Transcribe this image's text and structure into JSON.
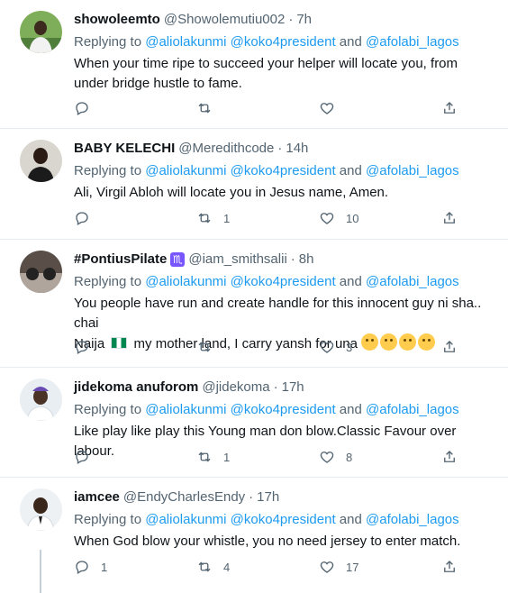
{
  "replying_label": "Replying to",
  "and_label": "and",
  "tweets": [
    {
      "name": "showoleemto",
      "handle": "@Showolemutiu002",
      "time": "7h",
      "mentions": [
        "@aliolakunmi",
        "@koko4president",
        "@afolabi_lagos"
      ],
      "text": "When your time ripe to succeed your helper will locate you, from under bridge hustle to fame.",
      "replies": "",
      "retweets": "",
      "likes": ""
    },
    {
      "name": "BABY KELECHI",
      "handle": "@Meredithcode",
      "time": "14h",
      "mentions": [
        "@aliolakunmi",
        "@koko4president",
        "@afolabi_lagos"
      ],
      "text": "Ali, Virgil Abloh will locate you in Jesus name, Amen.",
      "replies": "",
      "retweets": "1",
      "likes": "10"
    },
    {
      "name": "#PontiusPilate",
      "badge": "♏",
      "handle": "@iam_smithsalii",
      "time": "8h",
      "mentions": [
        "@aliolakunmi",
        "@koko4president",
        "@afolabi_lagos"
      ],
      "text_line1": "You people have run and create handle for this innocent guy ni sha.. chai",
      "text_line2_a": "Naija",
      "text_line2_b": "my mother land, I carry yansh for una",
      "replies": "",
      "retweets": "",
      "likes": "3"
    },
    {
      "name": "jidekoma anuforom",
      "handle": "@jidekoma",
      "time": "17h",
      "mentions": [
        "@aliolakunmi",
        "@koko4president",
        "@afolabi_lagos"
      ],
      "text": "Like play like play this Young man don blow.Classic Favour over labour.",
      "replies": "",
      "retweets": "1",
      "likes": "8"
    },
    {
      "name": "iamcee",
      "handle": "@EndyCharlesEndy",
      "time": "17h",
      "mentions": [
        "@aliolakunmi",
        "@koko4president",
        "@afolabi_lagos"
      ],
      "text": "When God blow your whistle, you no need jersey to enter match.",
      "replies": "1",
      "retweets": "4",
      "likes": "17"
    }
  ],
  "icons": {
    "reply": "reply-icon",
    "retweet": "retweet-icon",
    "like": "heart-icon",
    "share": "share-icon",
    "flag": "nigeria-flag-icon",
    "emoji": [
      "face-with-steam-icon",
      "face-with-steam-icon",
      "tears-of-joy-icon",
      "rolling-laughing-icon"
    ]
  },
  "colors": {
    "link": "#1d9bf0",
    "secondary_text": "#536471",
    "divider": "#e6ecf0",
    "badge": "#7856ff"
  }
}
